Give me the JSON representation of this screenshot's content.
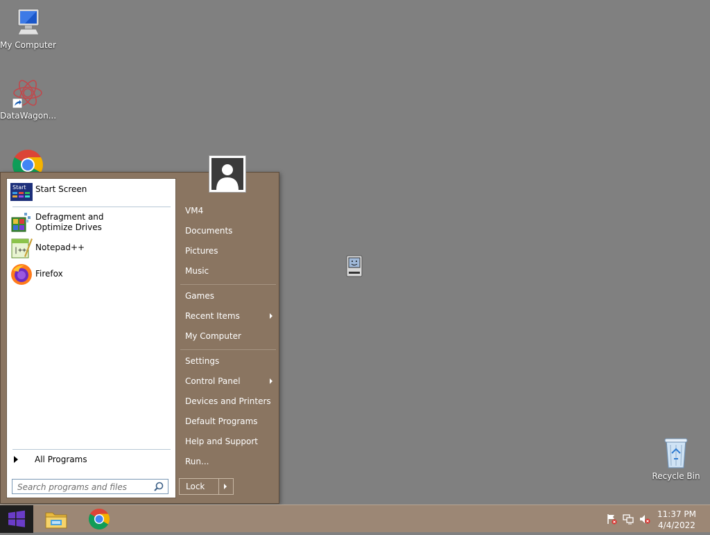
{
  "desktop": {
    "icons": [
      {
        "label": "My Computer",
        "icon": "computer-icon"
      },
      {
        "label": "DataWagon...",
        "icon": "datawagon-icon"
      },
      {
        "label": "",
        "icon": "chrome-icon"
      },
      {
        "label": "Recycle Bin",
        "icon": "recycle-bin-icon"
      }
    ],
    "floating_icon": "mac-face-icon"
  },
  "start_menu": {
    "programs": [
      {
        "label": "Start Screen",
        "icon": "start-screen-icon"
      },
      {
        "label": "Defragment and Optimize Drives",
        "icon": "defrag-icon"
      },
      {
        "label": "Notepad++",
        "icon": "notepadpp-icon"
      },
      {
        "label": "Firefox",
        "icon": "firefox-icon"
      }
    ],
    "all_programs_label": "All Programs",
    "search_placeholder": "Search programs and files",
    "right_items": [
      {
        "label": "VM4"
      },
      {
        "label": "Documents"
      },
      {
        "label": "Pictures"
      },
      {
        "label": "Music"
      },
      {
        "label": "Games"
      },
      {
        "label": "Recent Items"
      },
      {
        "label": "My Computer"
      },
      {
        "label": "Settings"
      },
      {
        "label": "Control Panel"
      },
      {
        "label": "Devices and Printers"
      },
      {
        "label": "Default Programs"
      },
      {
        "label": "Help and Support"
      },
      {
        "label": "Run..."
      }
    ],
    "lock_label": "Lock"
  },
  "taskbar": {
    "apps": [
      "file-explorer-icon",
      "chrome-icon"
    ],
    "tray_icons": [
      "action-center-flag-icon",
      "network-icon",
      "volume-muted-icon"
    ],
    "clock_time": "11:37 PM",
    "clock_date": "4/4/2022"
  },
  "colors": {
    "desktop": "#808080",
    "menu_frame": "#8a7561",
    "taskbar": "#9c8775",
    "start_button_logo": "#6a3cc8"
  }
}
